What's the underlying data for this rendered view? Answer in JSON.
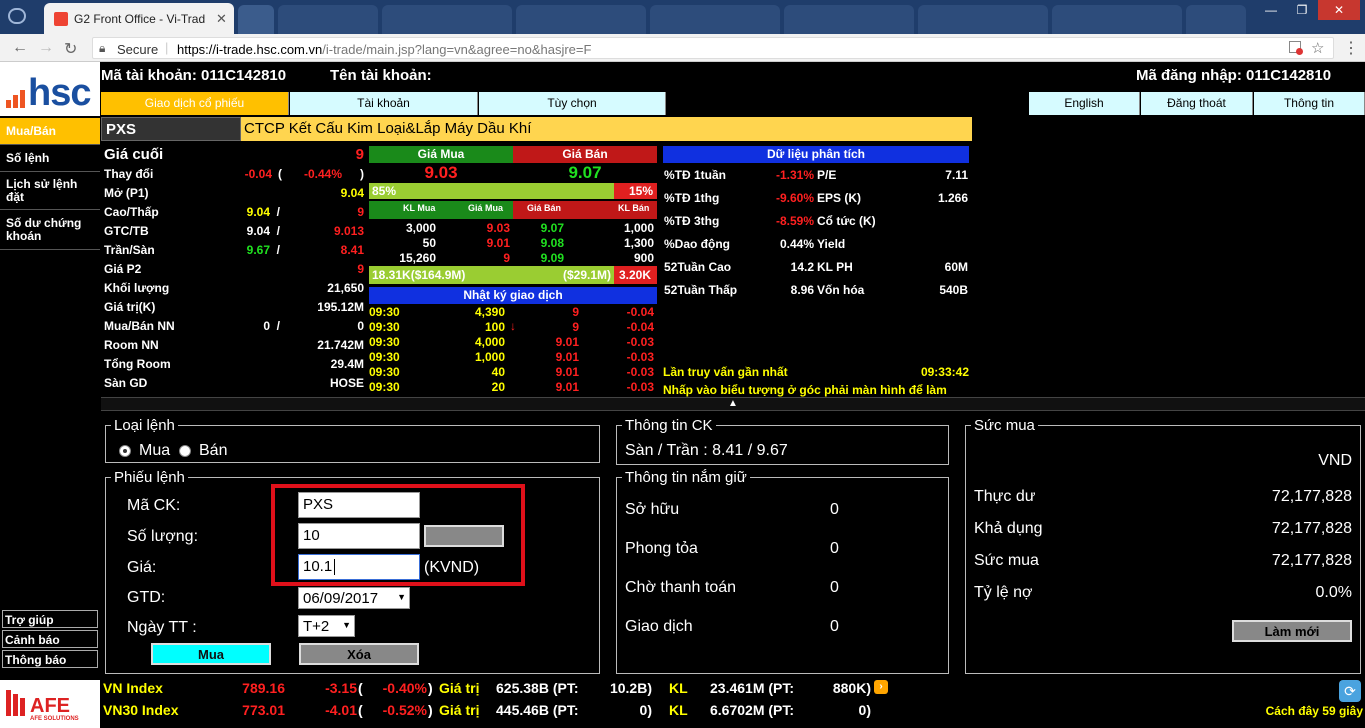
{
  "browser": {
    "tab_title": "G2 Front Office - Vi-Trad",
    "secure_label": "Secure",
    "url_domain": "https://i-trade.hsc.com.vn",
    "url_path": "/i-trade/main.jsp?lang=vn&agree=no&hasjre=F"
  },
  "header": {
    "logo_text": "hsc",
    "account_no_label": "Mã tài khoản: 011C142810",
    "account_name_label": "Tên tài khoản:",
    "login_id_label": "Mã đăng nhập: 011C142810"
  },
  "main_tabs": [
    "Giao dịch cổ phiếu",
    "Tài khoản",
    "Tùy chọn"
  ],
  "right_tabs": [
    "English",
    "Đăng thoát",
    "Thông tin"
  ],
  "sidebar": {
    "items": [
      "Mua/Bán",
      "Số lệnh",
      "Lịch sử lệnh đặt",
      "Số dư chứng khoán"
    ],
    "bottom_items": [
      "Trợ giúp",
      "Cảnh báo",
      "Thông báo"
    ],
    "footer_logo": "AFE SOLUTIONS"
  },
  "stock": {
    "symbol": "PXS",
    "company": "CTCP Kết Cấu Kim Loại&Lắp Máy Dầu Khí"
  },
  "quote": {
    "last_label": "Giá cuối",
    "last_value": "9",
    "change_label": "Thay đổi",
    "change_abs": "-0.04",
    "change_open": "(",
    "change_pct": "-0.44%",
    "change_close": ")",
    "open_label": "Mở (P1)",
    "open_value": "9.04",
    "hilo_label": "Cao/Thấp",
    "high": "9.04",
    "hilo_sep": "/",
    "low": "9",
    "gtc_label": "GTC/TB",
    "gtc": "9.04",
    "gtc_sep": "/",
    "avg": "9.013",
    "ceil_label": "Trần/Sàn",
    "ceiling": "9.67",
    "ceil_sep": "/",
    "floor": "8.41",
    "p2_label": "Giá P2",
    "p2": "9",
    "volume_label": "Khối lượng",
    "volume": "21,650",
    "value_label": "Giá trị(K)",
    "value": "195.12M",
    "foreign_label": "Mua/Bán NN",
    "foreign_buy": "0",
    "foreign_sep": "/",
    "foreign_sell": "0",
    "room_label": "Room NN",
    "room": "21.742M",
    "totalroom_label": "Tổng Room",
    "totalroom": "29.4M",
    "exch_label": "Sàn GD",
    "exch": "HOSE"
  },
  "orderbook": {
    "buy_header": "Giá Mua",
    "sell_header": "Giá Bán",
    "best_buy": "9.03",
    "best_sell": "9.07",
    "buy_pct": "85%",
    "sell_pct": "15%",
    "col_headers": [
      "KL Mua",
      "Giá Mua",
      "Giá Bán",
      "KL Bán"
    ],
    "rows": [
      {
        "bvol": "3,000",
        "bpx": "9.03",
        "spx": "9.07",
        "svol": "1,000"
      },
      {
        "bvol": "50",
        "bpx": "9.01",
        "spx": "9.08",
        "svol": "1,300"
      },
      {
        "bvol": "15,260",
        "bpx": "9",
        "spx": "9.09",
        "svol": "900"
      }
    ],
    "total_buy": "18.31K($164.9M)",
    "total_sell": "($29.1M)",
    "total_sell2": "3.20K"
  },
  "tradelog": {
    "header": "Nhật ký giao dịch",
    "rows": [
      {
        "t": "09:30",
        "v": "4,390",
        "p": "9",
        "c": "-0.04"
      },
      {
        "t": "09:30",
        "v": "100",
        "p": "9",
        "c": "-0.04"
      },
      {
        "t": "09:30",
        "v": "4,000",
        "p": "9.01",
        "c": "-0.03"
      },
      {
        "t": "09:30",
        "v": "1,000",
        "p": "9.01",
        "c": "-0.03"
      },
      {
        "t": "09:30",
        "v": "40",
        "p": "9.01",
        "c": "-0.03"
      },
      {
        "t": "09:30",
        "v": "20",
        "p": "9.01",
        "c": "-0.03"
      }
    ]
  },
  "analysis": {
    "header": "Dữ liệu phân tích",
    "rows": [
      {
        "l": "%TĐ 1tuần",
        "v": "-1.31%",
        "l2": "P/E",
        "v2": "7.11"
      },
      {
        "l": "%TĐ 1thg",
        "v": "-9.60%",
        "l2": "EPS (K)",
        "v2": "1.266"
      },
      {
        "l": "%TĐ 3thg",
        "v": "-8.59%",
        "l2": "Cổ tức (K)",
        "v2": ""
      },
      {
        "l": "%Dao động",
        "v": "0.44%",
        "l2": "Yield",
        "v2": ""
      },
      {
        "l": "52Tuần Cao",
        "v": "14.2",
        "l2": "KL PH",
        "v2": "60M"
      },
      {
        "l": "52Tuần Thấp",
        "v": "8.96",
        "l2": "Vốn hóa",
        "v2": "540B"
      }
    ],
    "last_query_label": "Lần truy vấn gần nhất",
    "last_query_time": "09:33:42",
    "hint": "Nhấp vào biểu tượng ở góc phải màn hình để làm"
  },
  "order_form": {
    "type_legend": "Loại lệnh",
    "buy_label": "Mua",
    "sell_label": "Bán",
    "ticket_legend": "Phiếu lệnh",
    "symbol_label": "Mã CK:",
    "symbol_value": "PXS",
    "qty_label": "Số lượng:",
    "qty_value": "10",
    "price_label": "Giá:",
    "price_value": "10.1",
    "price_unit": "(KVND)",
    "gtd_label": "GTD:",
    "gtd_value": "06/09/2017",
    "settle_label": "Ngày TT :",
    "settle_value": "T+2",
    "buy_button": "Mua",
    "clear_button": "Xóa"
  },
  "stock_info": {
    "legend": "Thông tin CK",
    "floor_ceil": "Sàn / Trần : 8.41 / 9.67"
  },
  "holdings": {
    "legend": "Thông tin nắm giữ",
    "rows": [
      {
        "l": "Sở hữu",
        "v": "0"
      },
      {
        "l": "Phong tỏa",
        "v": "0"
      },
      {
        "l": "Chờ thanh toán",
        "v": "0"
      },
      {
        "l": "Giao dịch",
        "v": "0"
      }
    ]
  },
  "buying_power": {
    "legend": "Sức mua",
    "currency": "VND",
    "rows": [
      {
        "l": "Thực dư",
        "v": "72,177,828"
      },
      {
        "l": "Khả dụng",
        "v": "72,177,828"
      },
      {
        "l": "Sức mua",
        "v": "72,177,828"
      },
      {
        "l": "Tỷ lệ nợ",
        "v": "0.0%"
      }
    ],
    "refresh_button": "Làm mới"
  },
  "indices": [
    {
      "name": "VN Index",
      "value": "789.16",
      "chg": "-3.15",
      "pct": "-0.40%",
      "val_label": "Giá trị",
      "val": "625.38B (PT:",
      "pt": "10.2B)",
      "kl_label": "KL",
      "kl": "23.461M (PT:",
      "klpt": "880K)"
    },
    {
      "name": "VN30 Index",
      "value": "773.01",
      "chg": "-4.01",
      "pct": "-0.52%",
      "val_label": "Giá trị",
      "val": "445.46B (PT:",
      "pt": "0)",
      "kl_label": "KL",
      "kl": "6.6702M (PT:",
      "klpt": "0)"
    }
  ],
  "footer_status": "Cách đây 59 giây"
}
